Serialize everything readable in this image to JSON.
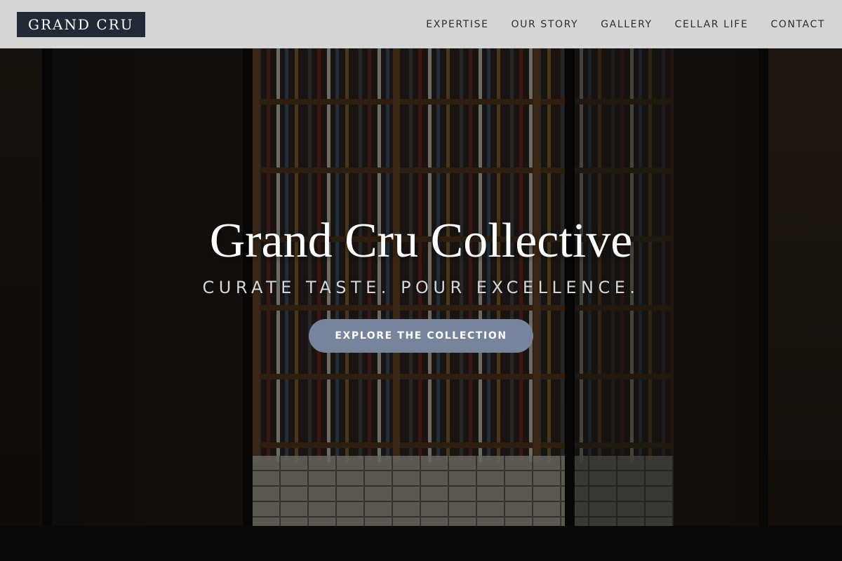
{
  "nav": {
    "logo": "GRAND CRU",
    "links": [
      "EXPERTISE",
      "OUR STORY",
      "GALLERY",
      "CELLAR LIFE",
      "CONTACT"
    ]
  },
  "hero": {
    "title": "Grand Cru Collective",
    "tagline": "CURATE TASTE. POUR EXCELLENCE.",
    "cta_label": "EXPLORE THE COLLECTION",
    "background_image": "dark storefront of a beer and wine shop with open glass doors and stocked shelves"
  },
  "colors": {
    "nav_background": "#d6d6d6",
    "logo_background": "#212a36",
    "nav_text": "#2b2f36",
    "cta_background": "#76859b",
    "hero_title": "#ffffff",
    "hero_tagline": "#d4d6da"
  }
}
